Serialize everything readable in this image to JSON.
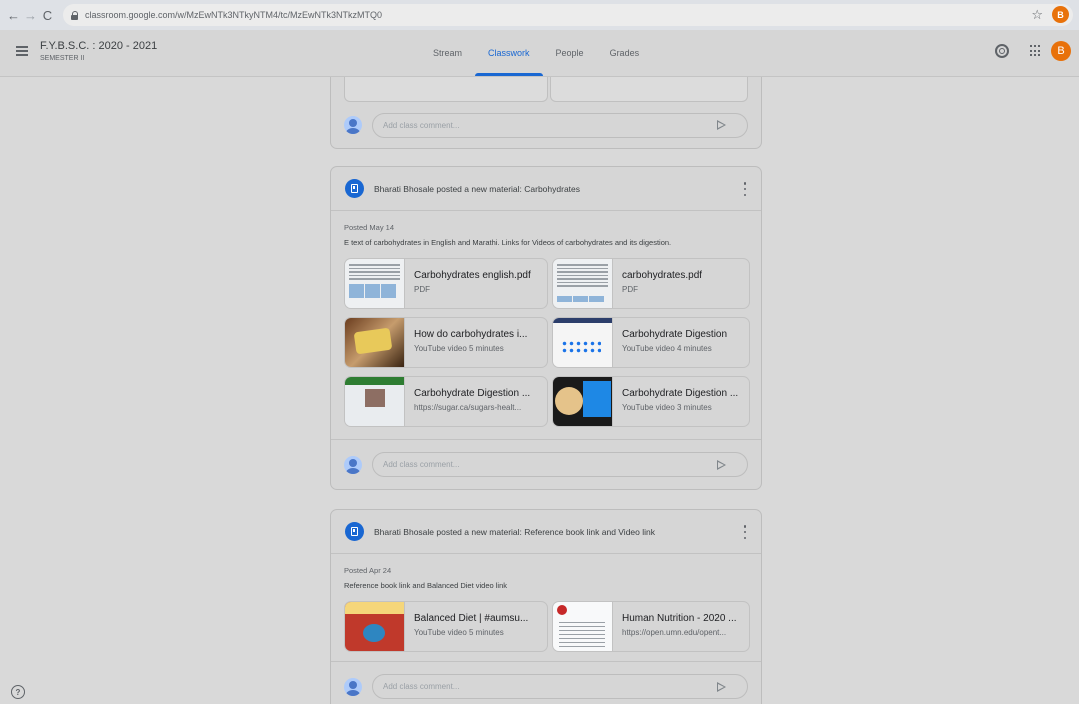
{
  "browser": {
    "url": "classroom.google.com/w/MzEwNTk3NTkyNTM4/tc/MzEwNTk3NTkzMTQ0",
    "profile_initial": "B"
  },
  "header": {
    "class_title": "F.Y.B.S.C. : 2020 - 2021",
    "class_subtitle": "SEMESTER II",
    "tabs": [
      "Stream",
      "Classwork",
      "People",
      "Grades"
    ],
    "active_tab": "Classwork",
    "avatar_initial": "B"
  },
  "comment_placeholder": "Add class comment...",
  "posts": [
    {
      "header": "Bharati Bhosale posted a new material: Carbohydrates",
      "posted": "Posted May 14",
      "description": "E text of carbohydrates in English and Marathi. Links for Videos of carbohydrates and its digestion.",
      "attachments": [
        {
          "title": "Carbohydrates english.pdf",
          "subtitle": "PDF",
          "thumb": "pdf"
        },
        {
          "title": "carbohydrates.pdf",
          "subtitle": "PDF",
          "thumb": "pdf"
        },
        {
          "title": "How do carbohydrates i...",
          "subtitle": "YouTube video  5 minutes",
          "thumb": "video"
        },
        {
          "title": "Carbohydrate Digestion",
          "subtitle": "YouTube video  4 minutes",
          "thumb": "video"
        },
        {
          "title": "Carbohydrate Digestion ...",
          "subtitle": "https://sugar.ca/sugars-healt...",
          "thumb": "link"
        },
        {
          "title": "Carbohydrate Digestion ...",
          "subtitle": "YouTube video  3 minutes",
          "thumb": "video"
        }
      ]
    },
    {
      "header": "Bharati Bhosale posted a new material: Reference book link and Video link",
      "posted": "Posted Apr 24",
      "description": "Reference book link and Balanced Diet video link",
      "attachments": [
        {
          "title": "Balanced Diet | #aumsu...",
          "subtitle": "YouTube video  5 minutes",
          "thumb": "video"
        },
        {
          "title": "Human Nutrition - 2020 ...",
          "subtitle": "https://open.umn.edu/opent...",
          "thumb": "link"
        }
      ]
    }
  ],
  "icons": {
    "back": "arrow-left-icon",
    "forward": "arrow-right-icon",
    "reload": "reload-icon",
    "lock": "lock-icon",
    "star": "star-icon",
    "menu": "menu-icon",
    "settings": "settings-icon",
    "apps": "apps-icon",
    "material": "material-icon",
    "more": "more-vert-icon",
    "send": "send-icon",
    "help": "help-icon"
  },
  "colors": {
    "accent": "#1967d2",
    "avatar": "#e8710a",
    "background": "#d9d9d9"
  }
}
